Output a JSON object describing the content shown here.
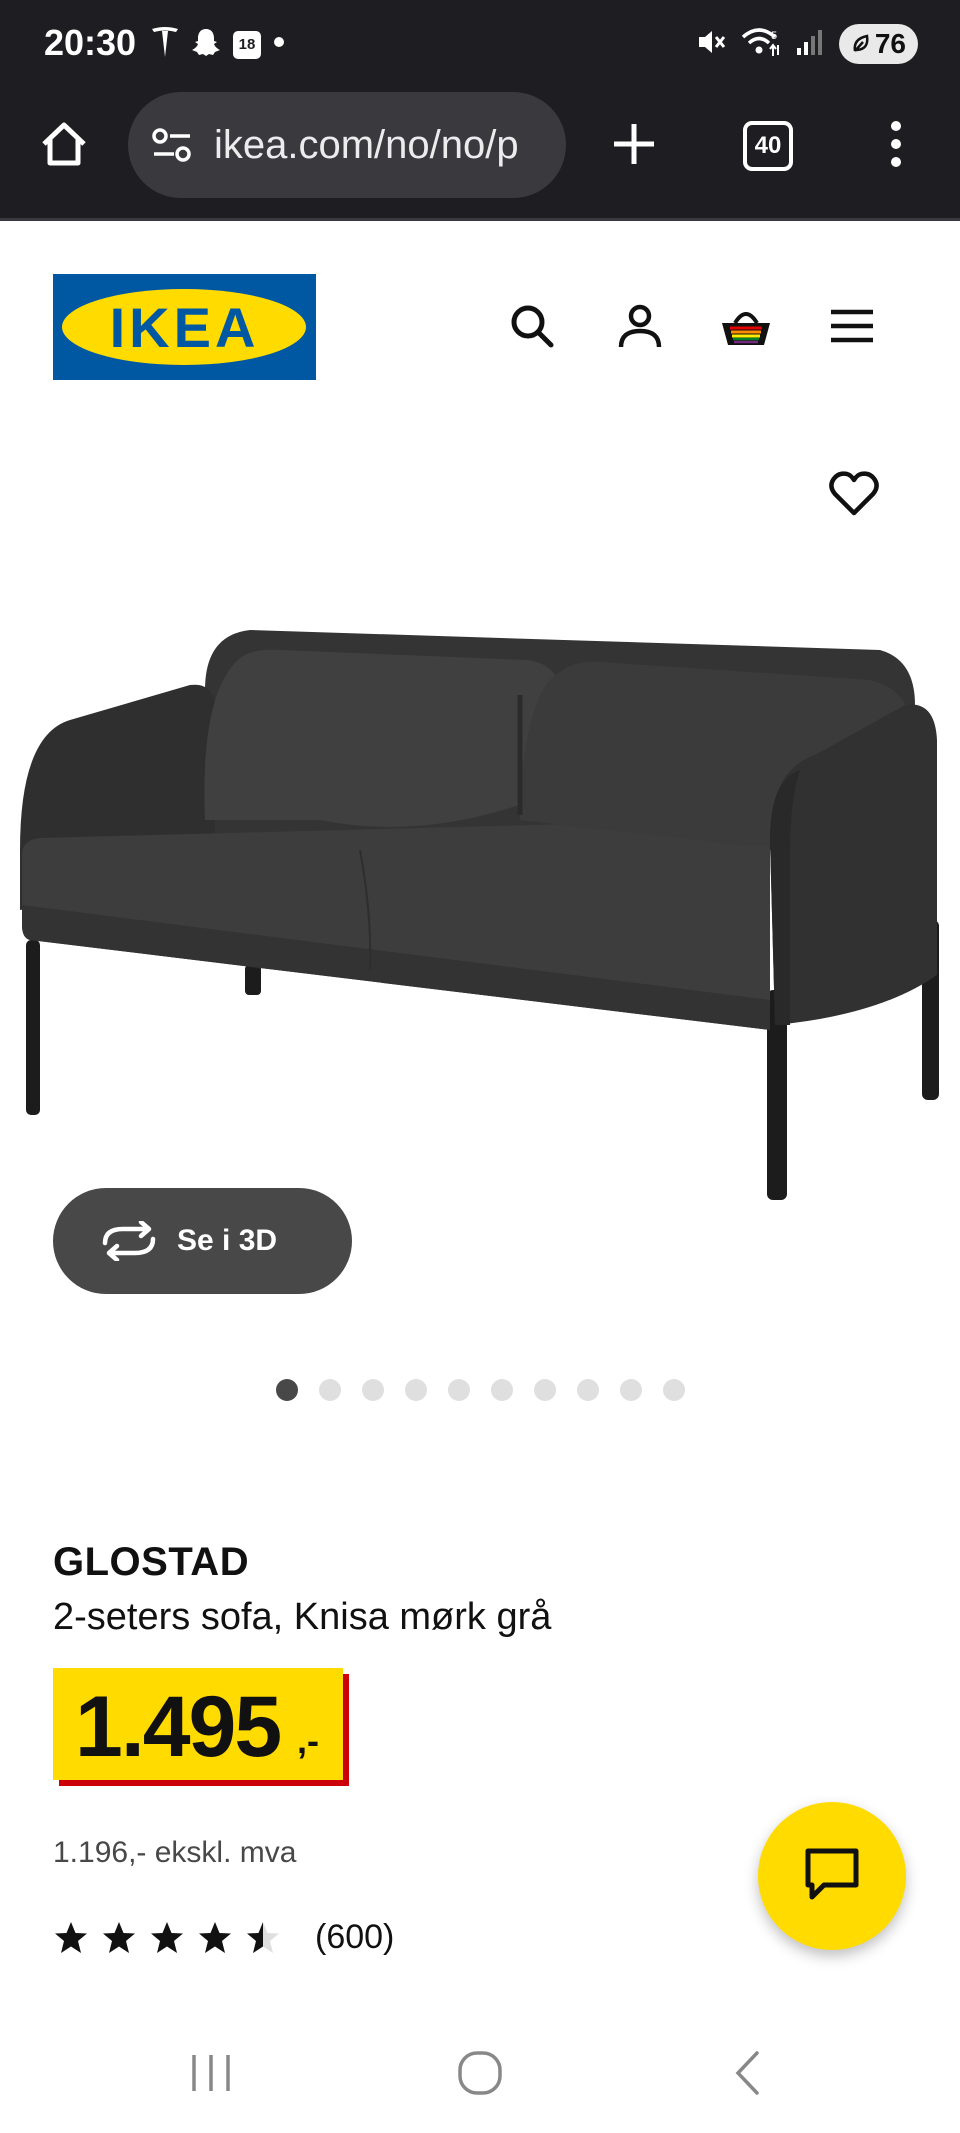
{
  "status_bar": {
    "time": "20:30",
    "calendar_badge": "18",
    "battery": "76",
    "icons_left": [
      "tesla-icon",
      "snapchat-icon",
      "calendar-icon",
      "dot-icon"
    ],
    "icons_right": [
      "mute-icon",
      "wifi-icon",
      "signal-icon",
      "battery-icon"
    ]
  },
  "browser": {
    "url": "ikea.com/no/no/p",
    "tab_count": "40"
  },
  "header": {
    "logo_text": "IKEA",
    "icons": [
      "search-icon",
      "account-icon",
      "basket-icon",
      "menu-icon"
    ]
  },
  "gallery": {
    "see_3d_label": "Se i 3D",
    "dot_count": 10,
    "active_dot": 0
  },
  "product": {
    "name": "GLOSTAD",
    "description": "2-seters sofa, Knisa mørk grå",
    "price": "1.495",
    "price_suffix": ",-",
    "price_ex_vat": "1.196,- ekskl. mva",
    "rating": 4.5,
    "rating_count": "(600)"
  },
  "colors": {
    "ikea_blue": "#0058a3",
    "ikea_yellow": "#ffdb00",
    "price_shadow_red": "#cc0008",
    "chrome_dark": "#1e1d21"
  }
}
